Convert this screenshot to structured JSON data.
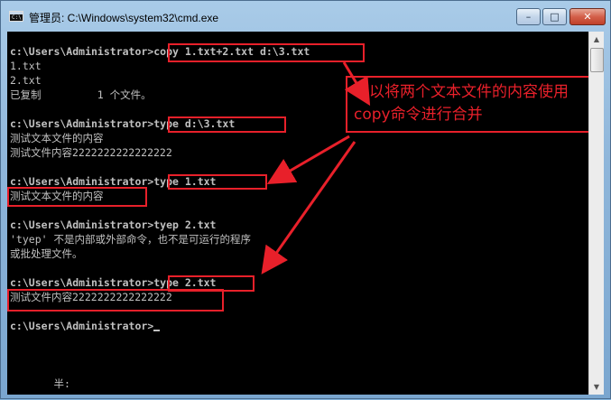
{
  "window": {
    "title": "管理员: C:\\Windows\\system32\\cmd.exe",
    "icon_glyph": "C:\\",
    "minimize_label": "–",
    "maximize_label": "□",
    "close_label": "✕"
  },
  "console": {
    "lines": [
      "c:\\Users\\Administrator>copy 1.txt+2.txt d:\\3.txt",
      "1.txt",
      "2.txt",
      "已复制         1 个文件。",
      "",
      "c:\\Users\\Administrator>type d:\\3.txt",
      "测试文本文件的内容",
      "测试文件内容2222222222222222",
      "",
      "c:\\Users\\Administrator>type 1.txt",
      "测试文本文件的内容",
      "",
      "c:\\Users\\Administrator>tyep 2.txt",
      "'tyep' 不是内部或外部命令，也不是可运行的程序",
      "或批处理文件。",
      "",
      "c:\\Users\\Administrator>type 2.txt",
      "测试文件内容2222222222222222",
      "",
      "c:\\Users\\Administrator>",
      "",
      "",
      "",
      "",
      "       半:"
    ]
  },
  "annotation": {
    "text": "可以将两个文本文件的内容使用copy命令进行合并",
    "color": "#e8202a"
  },
  "scrollbar": {
    "up_glyph": "▲",
    "down_glyph": "▼"
  }
}
